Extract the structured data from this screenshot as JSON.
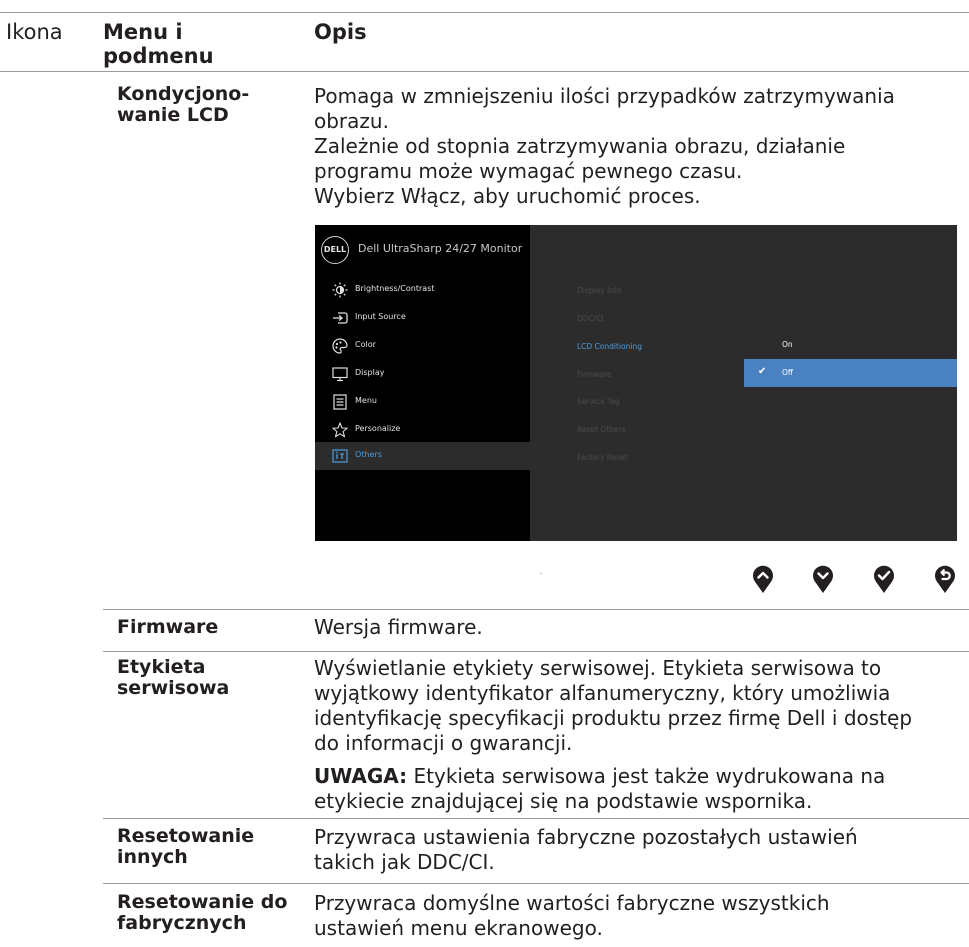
{
  "header": {
    "col_icon": "Ikona",
    "col_menu_line1": "Menu i",
    "col_menu_line2": "podmenu",
    "col_desc": "Opis"
  },
  "rows": {
    "lcd": {
      "menu_line1": "Kondycjono-",
      "menu_line2": "wanie LCD",
      "desc": [
        "Pomaga w zmniejszeniu ilości przypadków zatrzymywania",
        "obrazu.",
        "Zależnie od stopnia zatrzymywania obrazu, działanie",
        "programu może wymagać pewnego czasu.",
        "Wybierz Włącz, aby uruchomić proces."
      ]
    },
    "firmware": {
      "menu": "Firmware",
      "desc": "Wersja firmware."
    },
    "service_tag": {
      "menu_line1": "Etykieta",
      "menu_line2": "serwisowa",
      "desc": [
        "Wyświetlanie etykiety serwisowej. Etykieta serwisowa to",
        "wyjątkowy identyfikator alfanumeryczny, który umożliwia",
        "identyfikację specyfikacji produktu przez firmę Dell i dostęp",
        "do informacji o gwarancji."
      ],
      "note_label": "UWAGA:",
      "note_line1": " Etykieta serwisowa jest także wydrukowana na",
      "note_line2": "etykiecie znajdującej się na podstawie wspornika."
    },
    "reset_others": {
      "menu_line1": "Resetowanie",
      "menu_line2": "innych",
      "desc": [
        "Przywraca ustawienia fabryczne pozostałych ustawień",
        "takich jak DDC/CI."
      ]
    },
    "factory_reset": {
      "menu_line1": "Resetowanie do",
      "menu_line2": "fabrycznych",
      "desc": [
        "Przywraca domyślne wartości fabryczne wszystkich",
        "ustawień menu ekranowego."
      ]
    }
  },
  "osd": {
    "logo": "DELL",
    "title": "Dell UltraSharp 24/27 Monitor",
    "menu_items": [
      {
        "label": "Brightness/Contrast",
        "icon": "sun-icon"
      },
      {
        "label": "Input Source",
        "icon": "input-source-icon"
      },
      {
        "label": "Color",
        "icon": "color-palette-icon"
      },
      {
        "label": "Display",
        "icon": "display-monitor-icon"
      },
      {
        "label": "Menu",
        "icon": "menu-list-icon"
      },
      {
        "label": "Personalize",
        "icon": "star-icon"
      },
      {
        "label": "Others",
        "icon": "others-icon"
      }
    ],
    "active_menu": "Others",
    "submenu_items": [
      "Display Info",
      "DDC/CI",
      "LCD Conditioning",
      "Firmware",
      "Service Tag",
      "Reset Others",
      "Factory Reset"
    ],
    "active_submenu": "LCD Conditioning",
    "options": [
      "On",
      "Off"
    ],
    "selected_option": "Off",
    "accent_color": "#4a82c1",
    "active_text_color": "#4f9bd9"
  },
  "nav_buttons": [
    "up-arrow-icon",
    "down-arrow-icon",
    "check-icon",
    "back-icon"
  ]
}
